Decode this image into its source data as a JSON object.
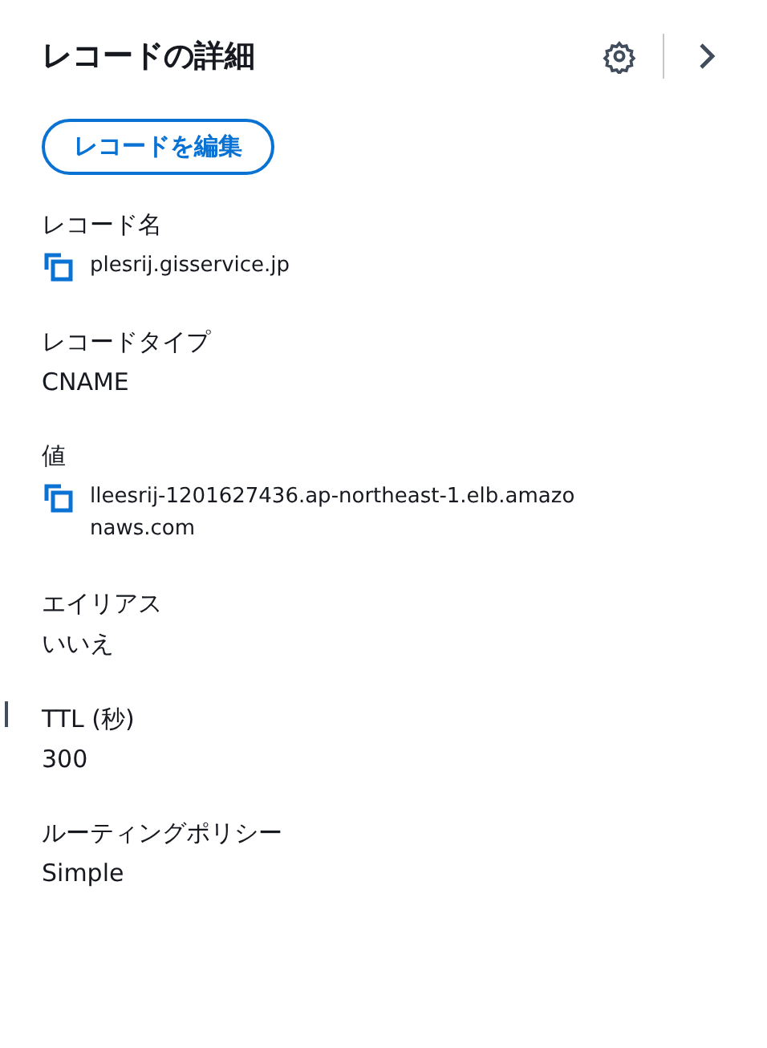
{
  "panel": {
    "title": "レコードの詳細"
  },
  "edit_button": "レコードを編集",
  "fields": [
    {
      "label": "レコード名",
      "value": "plesrij.gisservice.jp",
      "copyable": true
    },
    {
      "label": "レコードタイプ",
      "value": "CNAME",
      "copyable": false
    },
    {
      "label": "値",
      "value": "lleesrij-1201627436.ap-northeast-1.elb.amazonaws.com",
      "copyable": true
    },
    {
      "label": "エイリアス",
      "value": "いいえ",
      "copyable": false
    },
    {
      "label": "TTL (秒)",
      "value": "300",
      "copyable": false
    },
    {
      "label": "ルーティングポリシー",
      "value": "Simple",
      "copyable": false
    }
  ]
}
